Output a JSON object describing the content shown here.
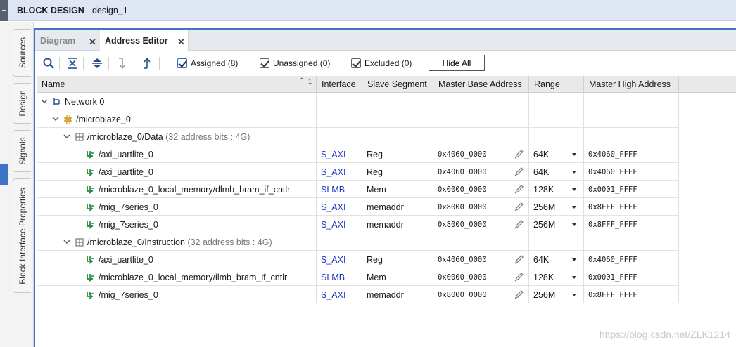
{
  "window": {
    "title_prefix": "BLOCK DESIGN",
    "title_suffix": " - design_1"
  },
  "side_tabs": [
    "Sources",
    "Design",
    "Signals",
    "Block Interface Properties"
  ],
  "tabs": [
    {
      "label": "Diagram",
      "active": false
    },
    {
      "label": "Address Editor",
      "active": true
    }
  ],
  "toolbar": {
    "icons": [
      "search-icon",
      "collapse-all-icon",
      "expand-all-icon",
      "move-down-icon",
      "move-up-icon"
    ],
    "assigned_label": "Assigned (8)",
    "unassigned_label": "Unassigned (0)",
    "excluded_label": "Excluded (0)",
    "hide_all_label": "Hide All"
  },
  "columns": {
    "name": "Name",
    "sort_indicator": "1",
    "interface": "Interface",
    "slave_segment": "Slave Segment",
    "base": "Master Base Address",
    "range": "Range",
    "high": "Master High Address"
  },
  "tree": {
    "network": "Network 0",
    "microblaze": "/microblaze_0",
    "data_space": {
      "label": "/microblaze_0/Data",
      "note": " (32 address bits : 4G)"
    },
    "instr_space": {
      "label": "/microblaze_0/Instruction",
      "note": " (32 address bits : 4G)"
    }
  },
  "data_rows": [
    {
      "name": "/axi_uartlite_0",
      "interface": "S_AXI",
      "segment": "Reg",
      "base": "0x4060_0000",
      "range": "64K",
      "high": "0x4060_FFFF"
    },
    {
      "name": "/axi_uartlite_0",
      "interface": "S_AXI",
      "segment": "Reg",
      "base": "0x4060_0000",
      "range": "64K",
      "high": "0x4060_FFFF"
    },
    {
      "name": "/microblaze_0_local_memory/dlmb_bram_if_cntlr",
      "interface": "SLMB",
      "segment": "Mem",
      "base": "0x0000_0000",
      "range": "128K",
      "high": "0x0001_FFFF"
    },
    {
      "name": "/mig_7series_0",
      "interface": "S_AXI",
      "segment": "memaddr",
      "base": "0x8000_0000",
      "range": "256M",
      "high": "0x8FFF_FFFF"
    },
    {
      "name": "/mig_7series_0",
      "interface": "S_AXI",
      "segment": "memaddr",
      "base": "0x8000_0000",
      "range": "256M",
      "high": "0x8FFF_FFFF"
    }
  ],
  "instr_rows": [
    {
      "name": "/axi_uartlite_0",
      "interface": "S_AXI",
      "segment": "Reg",
      "base": "0x4060_0000",
      "range": "64K",
      "high": "0x4060_FFFF"
    },
    {
      "name": "/microblaze_0_local_memory/ilmb_bram_if_cntlr",
      "interface": "SLMB",
      "segment": "Mem",
      "base": "0x0000_0000",
      "range": "128K",
      "high": "0x0001_FFFF"
    },
    {
      "name": "/mig_7series_0",
      "interface": "S_AXI",
      "segment": "memaddr",
      "base": "0x8000_0000",
      "range": "256M",
      "high": "0x8FFF_FFFF"
    }
  ],
  "watermark": "https://blog.csdn.net/ZLK1214",
  "colors": {
    "accent": "#3f73c8",
    "link": "#1a33c2",
    "slave_icon": "#1f8a3a"
  }
}
